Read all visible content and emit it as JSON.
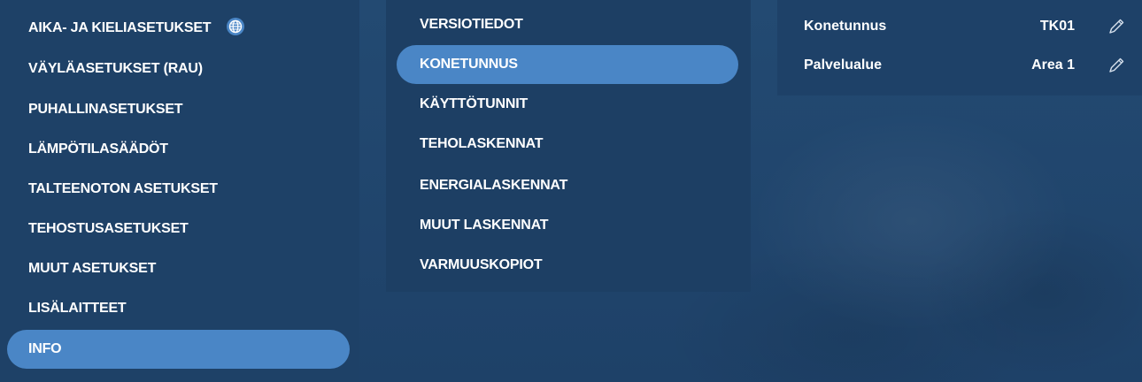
{
  "settings_menu": {
    "items": [
      {
        "label": "AIKA- JA KIELIASETUKSET",
        "icon": "globe-icon"
      },
      {
        "label": "VÄYLÄASETUKSET (RAU)"
      },
      {
        "label": "PUHALLINASETUKSET"
      },
      {
        "label": "LÄMPÖTILASÄÄDÖT"
      },
      {
        "label": "TALTEENOTON ASETUKSET"
      },
      {
        "label": "TEHOSTUSASETUKSET"
      },
      {
        "label": "MUUT ASETUKSET"
      },
      {
        "label": "LISÄLAITTEET"
      },
      {
        "label": "INFO",
        "active": true
      }
    ]
  },
  "info_menu": {
    "items": [
      {
        "label": "VERSIOTIEDOT"
      },
      {
        "label": "KONETUNNUS",
        "active": true
      },
      {
        "label": "KÄYTTÖTUNNIT"
      },
      {
        "label": "TEHOLASKENNAT"
      },
      {
        "label": "ENERGIALASKENNAT"
      },
      {
        "label": "MUUT LASKENNAT"
      },
      {
        "label": "VARMUUSKOPIOT"
      }
    ]
  },
  "properties": [
    {
      "label": "Konetunnus",
      "value": "TK01",
      "icon": "pencil-icon"
    },
    {
      "label": "Palvelualue",
      "value": "Area 1",
      "icon": "pencil-icon"
    }
  ],
  "colors": {
    "background": "#1f456d",
    "active_item": "#4a86c6",
    "text": "#ffffff"
  }
}
